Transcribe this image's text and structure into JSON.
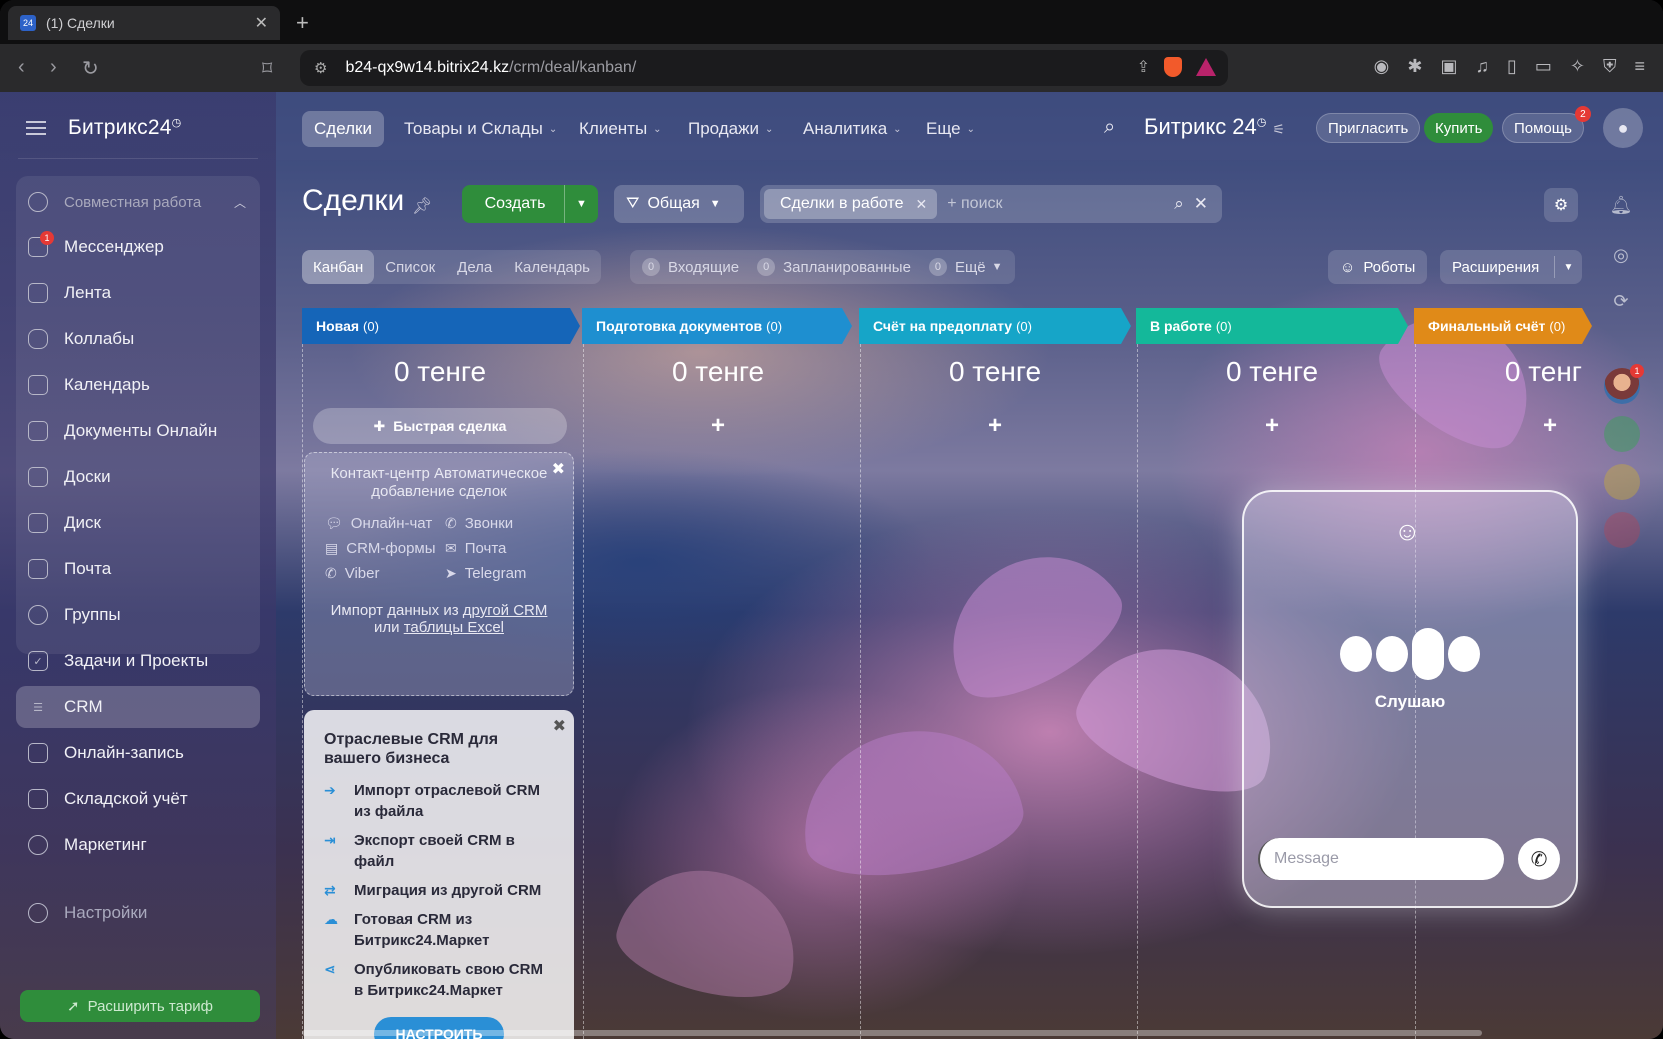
{
  "browser": {
    "tab_title": "(1) Сделки",
    "favicon_text": "24",
    "url_host": "b24-qx9w14.bitrix24.kz",
    "url_path": "/crm/deal/kanban/"
  },
  "sidebar": {
    "logo": "Битрикс24",
    "group_title": "Совместная работа",
    "messenger_badge": "1",
    "items": [
      {
        "label": "Мессенджер",
        "icon": "messenger-icon"
      },
      {
        "label": "Лента",
        "icon": "feed-icon"
      },
      {
        "label": "Коллабы",
        "icon": "collabs-icon"
      },
      {
        "label": "Календарь",
        "icon": "calendar-icon"
      },
      {
        "label": "Документы Онлайн",
        "icon": "documents-icon"
      },
      {
        "label": "Доски",
        "icon": "boards-icon"
      },
      {
        "label": "Диск",
        "icon": "disk-icon"
      },
      {
        "label": "Почта",
        "icon": "mail-icon"
      },
      {
        "label": "Группы",
        "icon": "groups-icon"
      }
    ],
    "items2": [
      {
        "label": "Задачи и Проекты",
        "icon": "tasks-icon"
      },
      {
        "label": "CRM",
        "icon": "crm-icon"
      },
      {
        "label": "Онлайн-запись",
        "icon": "booking-icon"
      },
      {
        "label": "Складской учёт",
        "icon": "warehouse-icon"
      },
      {
        "label": "Маркетинг",
        "icon": "marketing-icon"
      }
    ],
    "settings": "Настройки",
    "upgrade": "Расширить тариф"
  },
  "topnav": {
    "items": [
      "Сделки",
      "Товары и Склады",
      "Клиенты",
      "Продажи",
      "Аналитика",
      "Еще"
    ],
    "logo": "Битрикс 24",
    "invite": "Пригласить",
    "buy": "Купить",
    "help": "Помощь",
    "help_badge": "2"
  },
  "toolbar": {
    "title": "Сделки",
    "create": "Создать",
    "funnel": "Общая",
    "filter_chip": "Сделки в работе",
    "search_placeholder": "+ поиск",
    "views": [
      "Канбан",
      "Список",
      "Дела",
      "Календарь"
    ],
    "counters": [
      {
        "num": "0",
        "label": "Входящие"
      },
      {
        "num": "0",
        "label": "Запланированные"
      },
      {
        "num": "0",
        "label": "Ещё"
      }
    ],
    "robots": "Роботы",
    "extensions": "Расширения"
  },
  "columns": [
    {
      "title": "Новая",
      "count": "(0)",
      "sum": "0 тенге",
      "color": "#1565b8"
    },
    {
      "title": "Подготовка документов",
      "count": "(0)",
      "sum": "0 тенге",
      "color": "#1e8fd0"
    },
    {
      "title": "Счёт на предоплату",
      "count": "(0)",
      "sum": "0 тенге",
      "color": "#16a5c8"
    },
    {
      "title": "В работе",
      "count": "(0)",
      "sum": "0 тенге",
      "color": "#14b89a"
    },
    {
      "title": "Финальный счёт",
      "count": "(0)",
      "sum": "0 тенг",
      "color": "#e08a18"
    }
  ],
  "quick_deal": "Быстрая сделка",
  "contact_center": {
    "title": "Контакт-центр Автоматическое добавление сделок",
    "channels": [
      {
        "label": "Онлайн-чат",
        "icon": "chat-icon"
      },
      {
        "label": "Звонки",
        "icon": "phone-icon"
      },
      {
        "label": "CRM-формы",
        "icon": "form-icon"
      },
      {
        "label": "Почта",
        "icon": "mail-icon"
      },
      {
        "label": "Viber",
        "icon": "viber-icon"
      },
      {
        "label": "Telegram",
        "icon": "telegram-icon"
      }
    ],
    "import_text": "Импорт данных из",
    "import_link1": "другой CRM",
    "import_or": "или",
    "import_link2": "таблицы Excel"
  },
  "industry_crm": {
    "title": "Отраслевые CRM для вашего бизнеса",
    "items": [
      "Импорт отраслевой CRM из файла",
      "Экспорт своей CRM в файл",
      "Миграция из другой CRM",
      "Готовая CRM из Битрикс24.Маркет",
      "Опубликовать свою CRM в Битрикс24.Маркет"
    ],
    "button": "НАСТРОИТЬ"
  },
  "voice": {
    "status": "Слушаю",
    "placeholder": "Message"
  },
  "rail": {
    "avatar_badge": "1"
  }
}
